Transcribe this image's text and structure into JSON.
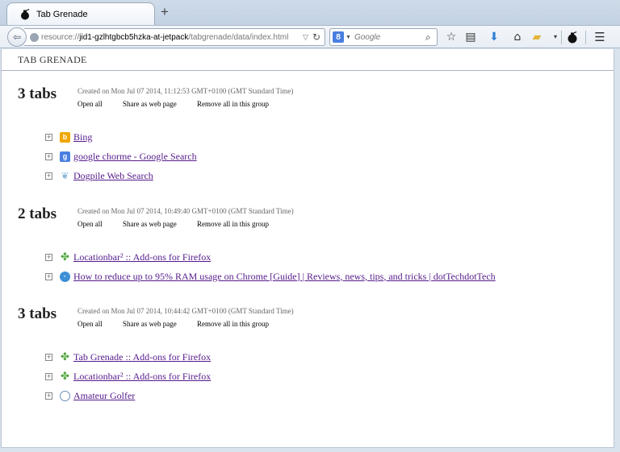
{
  "browser": {
    "tab_title": "Tab Grenade",
    "new_tab_label": "+",
    "url_prefix": "resource://",
    "url_host": "jid1-gzlhtgbcb5hzka-at-jetpack",
    "url_path": "/tabgrenade/data/index.html",
    "search_engine_letter": "8",
    "search_placeholder": "Google"
  },
  "app": {
    "title": "TAB GRENADE"
  },
  "groups": [
    {
      "count_label": "3 tabs",
      "created": "Created on Mon Jul 07 2014, 11:12:53 GMT+0100 (GMT Standard Time)",
      "actions": {
        "open_all": "Open all",
        "share": "Share as web page",
        "remove": "Remove all in this group"
      },
      "items": [
        {
          "title": "Bing",
          "favicon": "bing-icon"
        },
        {
          "title": "google chorme - Google Search",
          "favicon": "google-icon"
        },
        {
          "title": "Dogpile Web Search",
          "favicon": "dogpile-icon"
        }
      ]
    },
    {
      "count_label": "2 tabs",
      "created": "Created on Mon Jul 07 2014, 10:49:40 GMT+0100 (GMT Standard Time)",
      "actions": {
        "open_all": "Open all",
        "share": "Share as web page",
        "remove": "Remove all in this group"
      },
      "items": [
        {
          "title": "Locationbar² :: Add-ons for Firefox",
          "favicon": "puzzle-icon"
        },
        {
          "title": "How to reduce up to 95% RAM usage on Chrome [Guide] | Reviews, news, tips, and tricks | dotTechdotTech",
          "favicon": "dottech-icon"
        }
      ]
    },
    {
      "count_label": "3 tabs",
      "created": "Created on Mon Jul 07 2014, 10:44:42 GMT+0100 (GMT Standard Time)",
      "actions": {
        "open_all": "Open all",
        "share": "Share as web page",
        "remove": "Remove all in this group"
      },
      "items": [
        {
          "title": "Tab Grenade :: Add-ons for Firefox",
          "favicon": "puzzle-icon"
        },
        {
          "title": "Locationbar² :: Add-ons for Firefox",
          "favicon": "puzzle-icon"
        },
        {
          "title": "Amateur Golfer",
          "favicon": "golf-icon"
        }
      ]
    }
  ]
}
